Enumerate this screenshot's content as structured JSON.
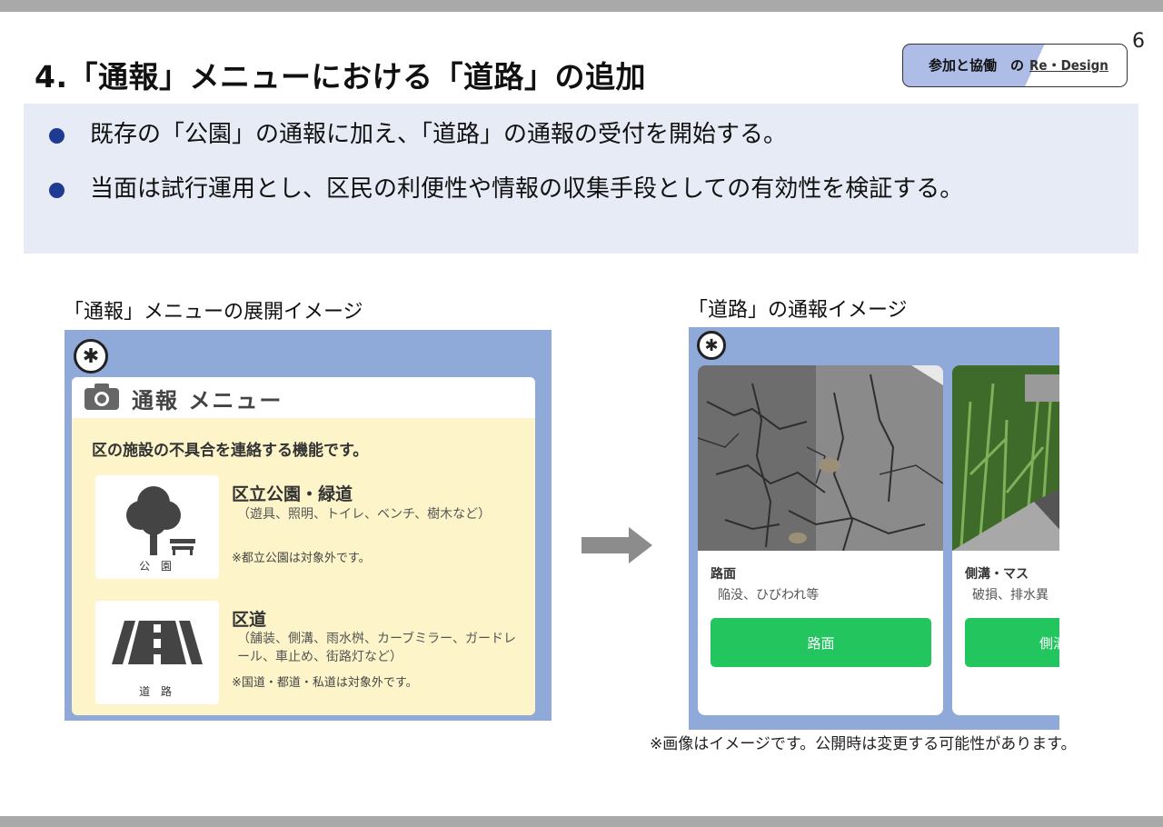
{
  "page_number": "6",
  "title": "4.「通報」メニューにおける「道路」の追加",
  "badge": {
    "main": "参加と協働　の",
    "accent": "Re・Design",
    "accent_color": "#aebde6"
  },
  "bullets": [
    "既存の「公園」の通報に加え、「道路」の通報の受付を開始する。",
    "当面は試行運用とし、区民の利便性や情報の収集手段としての有効性を検証する。"
  ],
  "left_caption": "「通報」メニューの展開イメージ",
  "right_caption": "「道路」の通報イメージ",
  "menu": {
    "header_title": "通報 メニュー",
    "description": "区の施設の不具合を連絡する機能です。",
    "items": [
      {
        "icon_name": "tree-bench-icon",
        "icon_label": "公 園",
        "title": "区立公園・緑道",
        "detail": "（遊具、照明、トイレ、ベンチ、樹木など）",
        "note": "※都立公園は対象外です。"
      },
      {
        "icon_name": "road-icon",
        "icon_label": "道 路",
        "title": "区道",
        "detail": "（舗装、側溝、雨水桝、カーブミラー、ガードレール、車止め、街路灯など）",
        "note": "※国道・都道・私道は対象外です。"
      }
    ]
  },
  "road_cards": [
    {
      "label": "路面",
      "sub": "陥没、ひびわれ等",
      "button": "路面",
      "photo": "cracked-asphalt-photo"
    },
    {
      "label": "側溝・マス",
      "sub": "破損、排水異",
      "button": "側溝",
      "photo": "gutter-grass-photo"
    }
  ],
  "footnote": "※画像はイメージです。公開時は変更する可能性があります。",
  "colors": {
    "bullet_dot": "#1f3a93",
    "bullet_bg": "#e7ebf6",
    "app_bg": "#8fa9d9",
    "menu_card_bg": "#fdf5c9",
    "button_green": "#22c55e",
    "arrow_gray": "#8c8c8c"
  }
}
